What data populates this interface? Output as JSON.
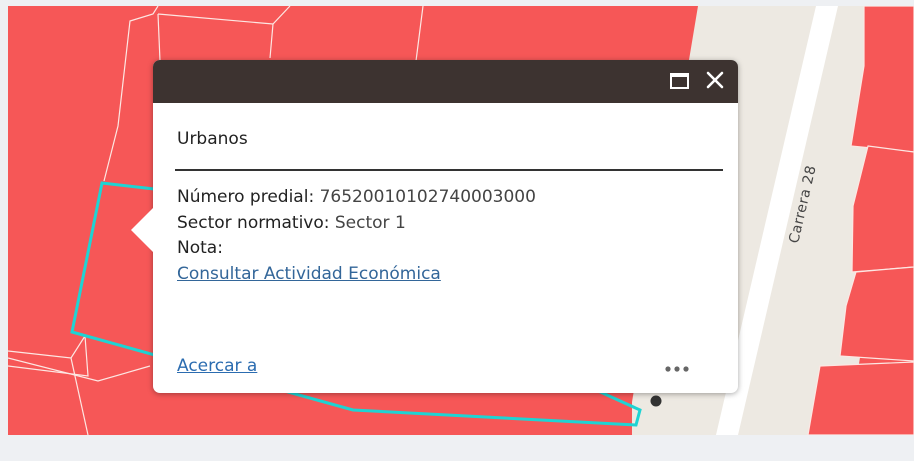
{
  "map": {
    "street_name": "Carrera 28",
    "colors": {
      "parcel_fill": "#f65757",
      "parcel_outline": "#fde7e3",
      "street_fill": "#ede9e2",
      "street_center": "#ffffff",
      "selection_outline": "#1fd3d3",
      "point_marker": "#333333"
    }
  },
  "popup": {
    "title": "Urbanos",
    "fields": {
      "numero_predial_label": "Número predial:",
      "numero_predial_value": "76520010102740003000",
      "sector_label": "Sector normativo:",
      "sector_value": "Sector 1",
      "nota_label": "Nota:",
      "nota_value": "",
      "actividad_link": "Consultar Actividad Económica"
    },
    "actions": {
      "zoom_to": "Acercar a",
      "more": "•••"
    },
    "header_icons": [
      "maximize-icon",
      "close-icon"
    ],
    "colors": {
      "header": "#3d3330",
      "link": "#2b6cb0"
    }
  }
}
